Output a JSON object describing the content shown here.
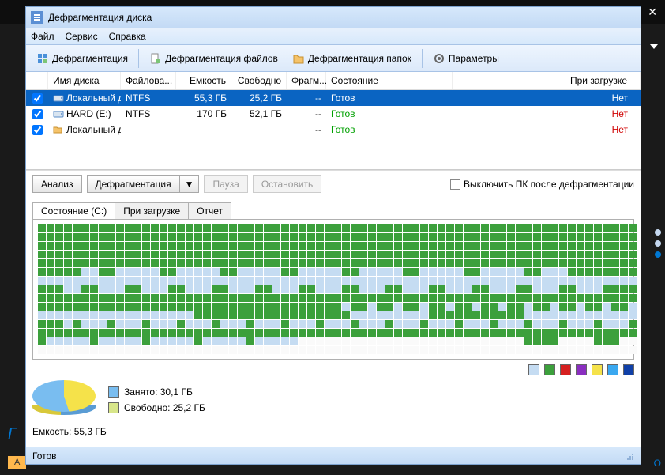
{
  "window_title": "Дефрагментация диска",
  "menubar": {
    "file": "Файл",
    "service": "Сервис",
    "help": "Справка"
  },
  "toolbar": {
    "defrag": "Дефрагментация",
    "defrag_files": "Дефрагментация файлов",
    "defrag_folders": "Дефрагментация папок",
    "params": "Параметры"
  },
  "table": {
    "headers": {
      "name": "Имя диска",
      "fs": "Файлова...",
      "capacity": "Емкость",
      "free": "Свободно",
      "frag": "Фрагм...",
      "state": "Состояние",
      "boot": "При загрузке"
    },
    "rows": [
      {
        "checked": true,
        "icon": "drive-icon",
        "name": "Локальный д...",
        "fs": "NTFS",
        "cap": "55,3 ГБ",
        "free": "25,2 ГБ",
        "frag": "--",
        "state": "Готов",
        "boot": "Нет",
        "selected": true
      },
      {
        "checked": true,
        "icon": "drive-icon",
        "name": "HARD (E:)",
        "fs": "NTFS",
        "cap": "170 ГБ",
        "free": "52,1 ГБ",
        "frag": "--",
        "state": "Готов",
        "boot": "Нет",
        "selected": false
      },
      {
        "checked": true,
        "icon": "folder-icon",
        "name": "Локальный д...",
        "fs": "",
        "cap": "",
        "free": "",
        "frag": "--",
        "state": "Готов",
        "boot": "Нет",
        "selected": false
      }
    ]
  },
  "actions": {
    "analyze": "Анализ",
    "defrag": "Дефрагментация",
    "pause": "Пауза",
    "stop": "Остановить",
    "shutdown_chk": "Выключить ПК после дефрагментации"
  },
  "tabs": {
    "state": "Состояние (C:)",
    "boot": "При загрузке",
    "report": "Отчет"
  },
  "legend_colors": [
    "#c5dcf2",
    "#3ca03c",
    "#d62020",
    "#8a2ec0",
    "#f5e24a",
    "#3aa8f0",
    "#1040a8"
  ],
  "pie_legend": {
    "used": {
      "label": "Занято: 30,1 ГБ",
      "color": "#79bdf0"
    },
    "free": {
      "label": "Свободно: 25,2 ГБ",
      "color": "#d8e68a"
    }
  },
  "capacity_line": "Емкость: 55,3 ГБ",
  "statusbar_text": "Готов",
  "bg_tray_label": "А",
  "bg_tray_right": "О"
}
